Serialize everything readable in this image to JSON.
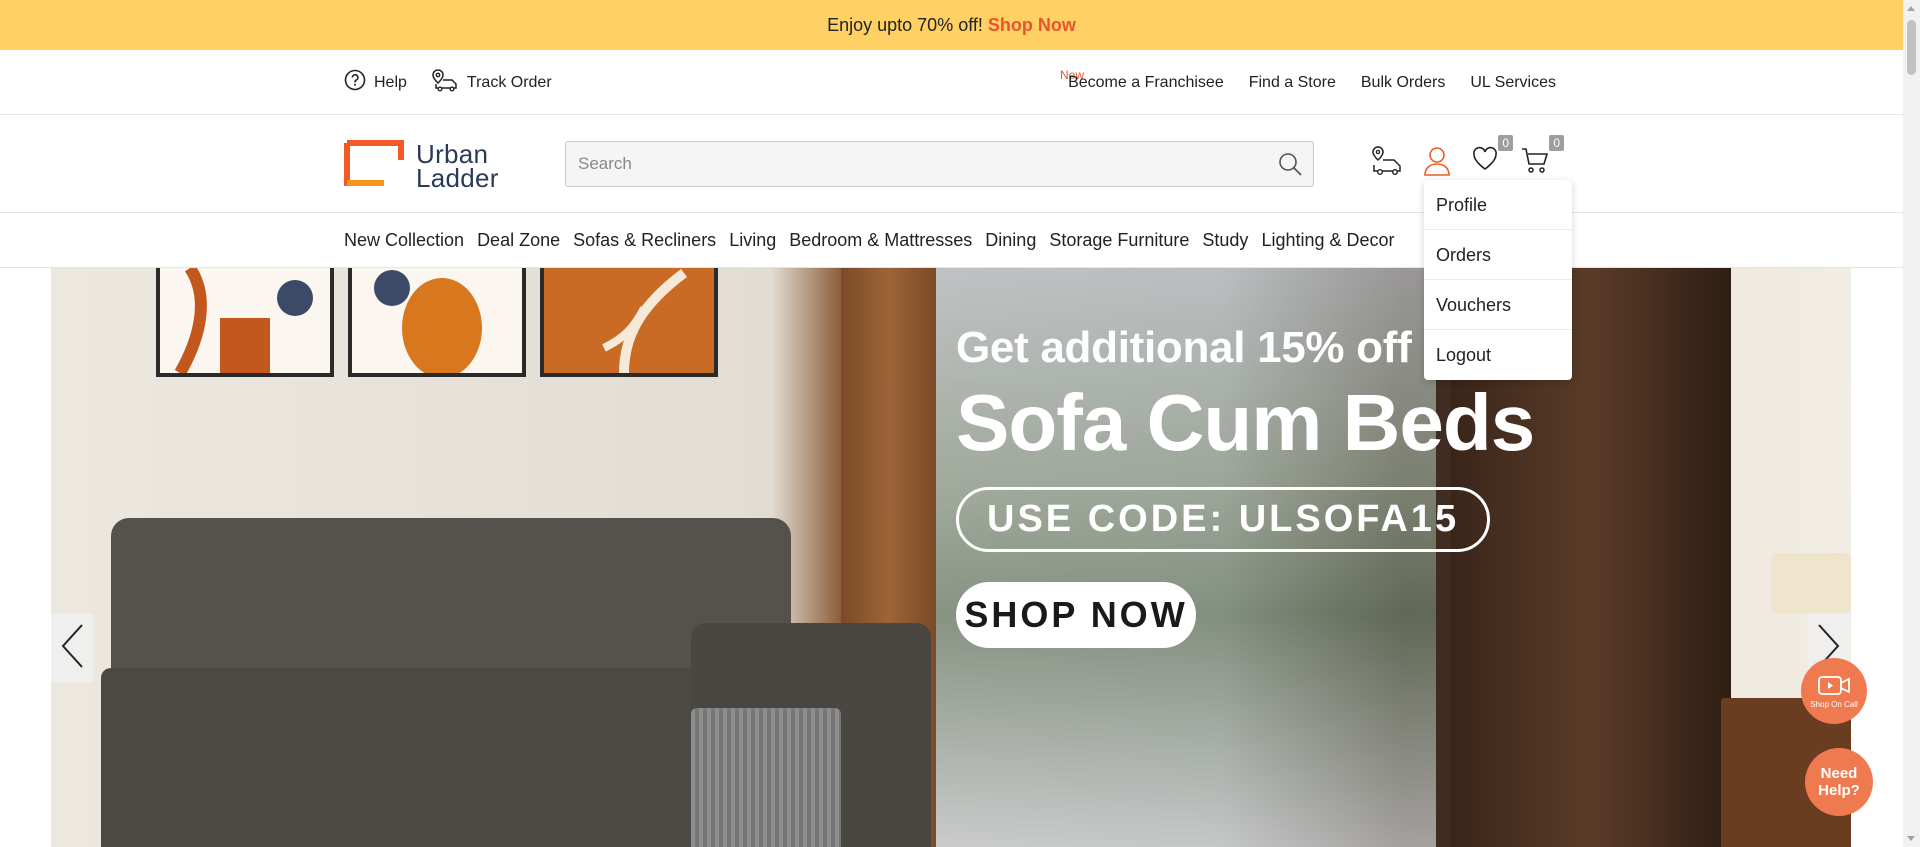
{
  "promo": {
    "text": "Enjoy upto 70% off!",
    "cta": "Shop Now"
  },
  "utility": {
    "help": "Help",
    "track_order": "Track Order",
    "new_tag": "New",
    "links": [
      "Become a Franchisee",
      "Find a Store",
      "Bulk Orders",
      "UL Services"
    ]
  },
  "header": {
    "logo_line1": "Urban",
    "logo_line2": "Ladder",
    "search_placeholder": "Search",
    "wishlist_count": "0",
    "cart_count": "0"
  },
  "nav": {
    "items": [
      "New Collection",
      "Deal Zone",
      "Sofas & Recliners",
      "Living",
      "Bedroom & Mattresses",
      "Dining",
      "Storage Furniture",
      "Study",
      "Lighting & Decor"
    ]
  },
  "account_menu": {
    "items": [
      "Profile",
      "Orders",
      "Vouchers",
      "Logout"
    ]
  },
  "hero": {
    "subtitle": "Get additional 15% off",
    "title": "Sofa Cum Beds",
    "code": "USE CODE: ULSOFA15",
    "cta": "SHOP NOW"
  },
  "floating": {
    "shop_on_call": "Shop On Call",
    "need_help": "Need Help?"
  },
  "colors": {
    "promo_bg": "#ffd164",
    "accent": "#e8542f",
    "fab": "#f07a4f"
  }
}
